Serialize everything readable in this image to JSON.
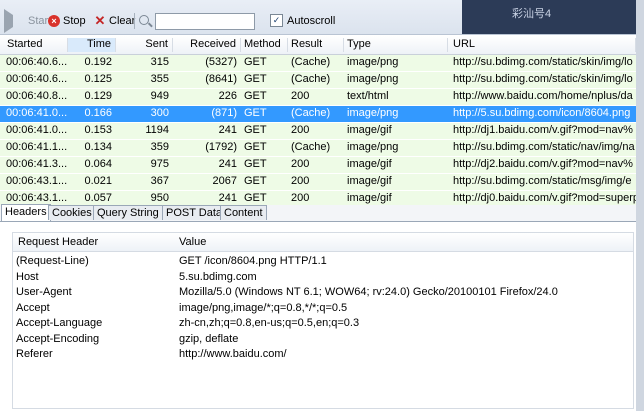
{
  "toolbar": {
    "start_label": "Start",
    "stop_label": "Stop",
    "clear_label": "Clear",
    "search_value": "",
    "autoscroll_label": "Autoscroll",
    "autoscroll_checked": true
  },
  "corner_text": "彩汕号4",
  "columns": [
    "Started",
    "Time",
    "Sent",
    "Received",
    "Method",
    "Result",
    "Type",
    "URL"
  ],
  "sorted_column": "Time",
  "requests": [
    {
      "started": "00:06:40.6...",
      "time": "0.192",
      "sent": "315",
      "received": "(5327)",
      "method": "GET",
      "result": "(Cache)",
      "type": "image/png",
      "url": "http://su.bdimg.com/static/skin/img/lo"
    },
    {
      "started": "00:06:40.6...",
      "time": "0.125",
      "sent": "355",
      "received": "(8641)",
      "method": "GET",
      "result": "(Cache)",
      "type": "image/png",
      "url": "http://su.bdimg.com/static/skin/img/lo"
    },
    {
      "started": "00:06:40.8...",
      "time": "0.129",
      "sent": "949",
      "received": "226",
      "method": "GET",
      "result": "200",
      "type": "text/html",
      "url": "http://www.baidu.com/home/nplus/da"
    },
    {
      "started": "00:06:41.0...",
      "time": "0.166",
      "sent": "300",
      "received": "(871)",
      "method": "GET",
      "result": "(Cache)",
      "type": "image/png",
      "url": "http://5.su.bdimg.com/icon/8604.png",
      "selected": true
    },
    {
      "started": "00:06:41.0...",
      "time": "0.153",
      "sent": "1194",
      "received": "241",
      "method": "GET",
      "result": "200",
      "type": "image/gif",
      "url": "http://dj1.baidu.com/v.gif?mod=nav%"
    },
    {
      "started": "00:06:41.1...",
      "time": "0.134",
      "sent": "359",
      "received": "(1792)",
      "method": "GET",
      "result": "(Cache)",
      "type": "image/png",
      "url": "http://su.bdimg.com/static/nav/img/na"
    },
    {
      "started": "00:06:41.3...",
      "time": "0.064",
      "sent": "975",
      "received": "241",
      "method": "GET",
      "result": "200",
      "type": "image/gif",
      "url": "http://dj2.baidu.com/v.gif?mod=nav%"
    },
    {
      "started": "00:06:43.1...",
      "time": "0.021",
      "sent": "367",
      "received": "2067",
      "method": "GET",
      "result": "200",
      "type": "image/gif",
      "url": "http://su.bdimg.com/static/msg/img/e"
    },
    {
      "started": "00:06:43.1...",
      "time": "0.057",
      "sent": "950",
      "received": "241",
      "method": "GET",
      "result": "200",
      "type": "image/gif",
      "url": "http://dj0.baidu.com/v.gif?mod=superp"
    }
  ],
  "detail_tabs": [
    "Headers",
    "Cookies",
    "Query String",
    "POST Data",
    "Content"
  ],
  "active_detail_tab": "Headers",
  "detail": {
    "header_col": "Request Header",
    "value_col": "Value",
    "headers": [
      {
        "name": "(Request-Line)",
        "value": "GET /icon/8604.png HTTP/1.1"
      },
      {
        "name": "Host",
        "value": "5.su.bdimg.com"
      },
      {
        "name": "User-Agent",
        "value": "Mozilla/5.0 (Windows NT 6.1; WOW64; rv:24.0) Gecko/20100101 Firefox/24.0"
      },
      {
        "name": "Accept",
        "value": "image/png,image/*;q=0.8,*/*;q=0.5"
      },
      {
        "name": "Accept-Language",
        "value": "zh-cn,zh;q=0.8,en-us;q=0.5,en;q=0.3"
      },
      {
        "name": "Accept-Encoding",
        "value": "gzip, deflate"
      },
      {
        "name": "Referer",
        "value": "http://www.baidu.com/"
      }
    ]
  },
  "colors": {
    "row_bg": "#eefbe6",
    "selected_bg": "#3399ff",
    "toolbar_bg": "#dbe3ee"
  }
}
